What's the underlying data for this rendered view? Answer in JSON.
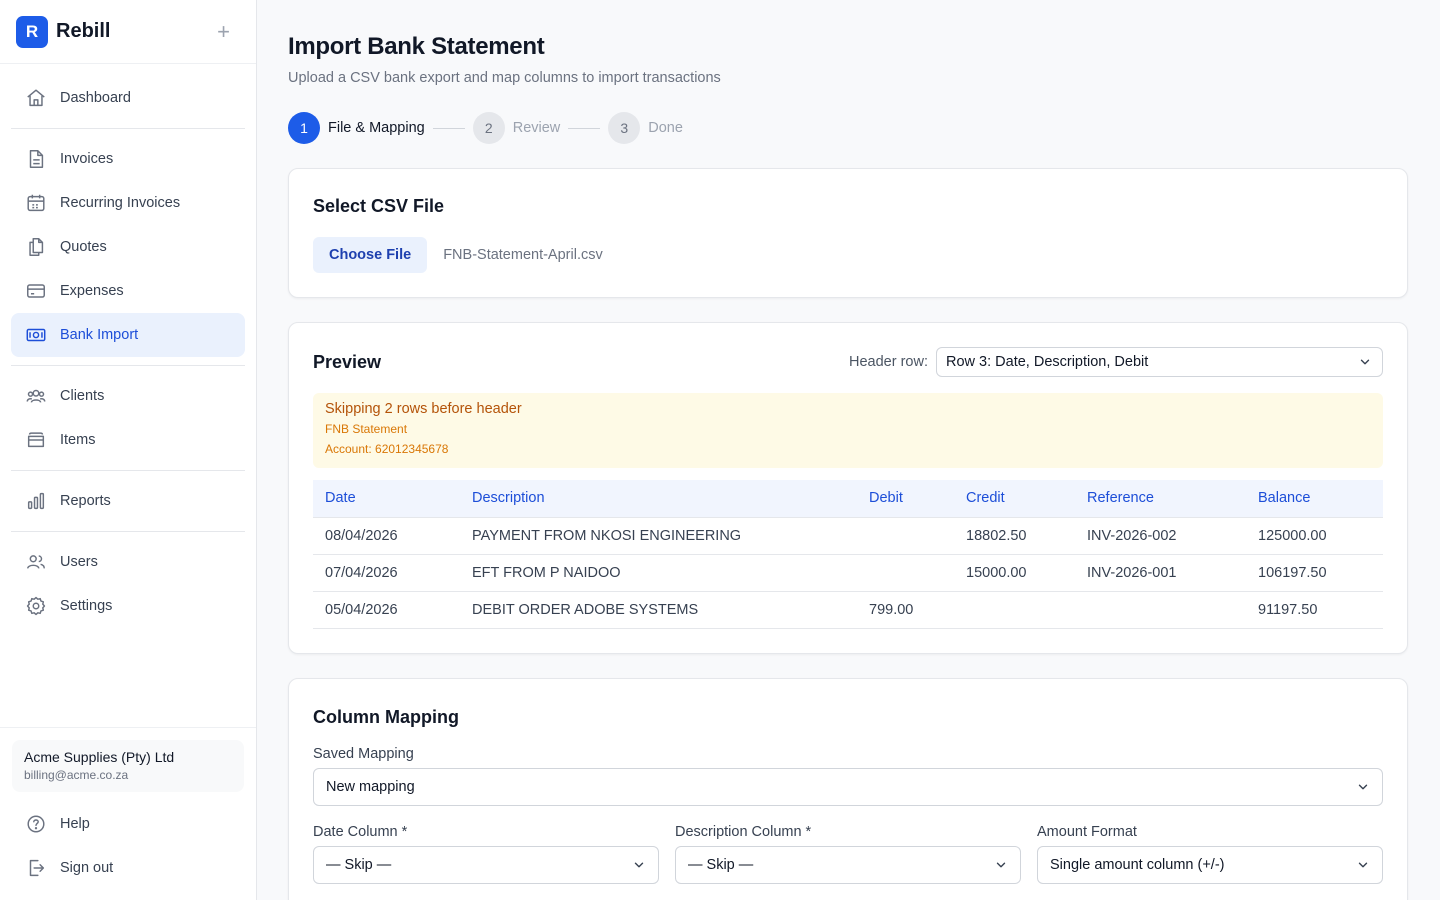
{
  "brand": {
    "logo_letter": "R",
    "name": "Rebill",
    "add_symbol": "+"
  },
  "nav": {
    "dashboard": "Dashboard",
    "invoices": "Invoices",
    "recurring_invoices": "Recurring Invoices",
    "quotes": "Quotes",
    "expenses": "Expenses",
    "bank_import": "Bank Import",
    "clients": "Clients",
    "items": "Items",
    "reports": "Reports",
    "users": "Users",
    "settings": "Settings"
  },
  "account": {
    "name": "Acme Supplies (Pty) Ltd",
    "email": "billing@acme.co.za"
  },
  "bottom_nav": {
    "help": "Help",
    "sign_out": "Sign out"
  },
  "page": {
    "title": "Import Bank Statement",
    "subtitle": "Upload a CSV bank export and map columns to import transactions"
  },
  "steps": [
    {
      "number": "1",
      "label": "File & Mapping"
    },
    {
      "number": "2",
      "label": "Review"
    },
    {
      "number": "3",
      "label": "Done"
    }
  ],
  "file_card": {
    "title": "Select CSV File",
    "choose_label": "Choose File",
    "file_name": "FNB-Statement-April.csv"
  },
  "preview": {
    "title": "Preview",
    "header_row_label": "Header row:",
    "header_row_value": "Row 3: Date, Description, Debit",
    "warning_title": "Skipping 2 rows before header",
    "warning_lines": [
      "FNB Statement",
      "Account: 62012345678"
    ],
    "columns": [
      "Date",
      "Description",
      "Debit",
      "Credit",
      "Reference",
      "Balance"
    ],
    "rows": [
      [
        "08/04/2026",
        "PAYMENT FROM NKOSI ENGINEERING",
        "",
        "18802.50",
        "INV-2026-002",
        "125000.00"
      ],
      [
        "07/04/2026",
        "EFT FROM P NAIDOO",
        "",
        "15000.00",
        "INV-2026-001",
        "106197.50"
      ],
      [
        "05/04/2026",
        "DEBIT ORDER ADOBE SYSTEMS",
        "799.00",
        "",
        "",
        "91197.50"
      ]
    ]
  },
  "mapping": {
    "title": "Column Mapping",
    "saved_label": "Saved Mapping",
    "saved_value": "New mapping",
    "date_label": "Date Column *",
    "date_value": "— Skip —",
    "description_label": "Description Column *",
    "description_value": "— Skip —",
    "amount_label": "Amount Format",
    "amount_value": "Single amount column (+/-)"
  },
  "colors": {
    "accent": "#1d5ce8",
    "active_bg": "#eaf1fd",
    "warning_bg": "#fefae6",
    "warning_text": "#b45309"
  }
}
